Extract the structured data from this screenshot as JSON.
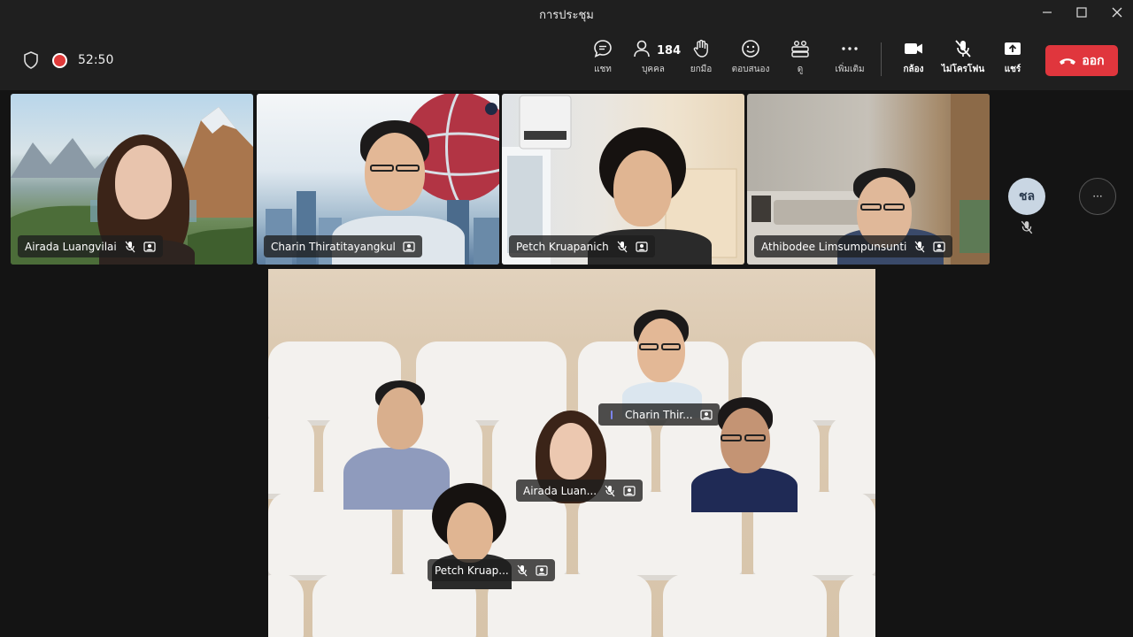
{
  "window": {
    "title": "การประชุม"
  },
  "toolbar": {
    "timer": "52:50",
    "chat_label": "แชท",
    "people_label": "บุคคล",
    "people_count": "184",
    "raise_label": "ยกมือ",
    "react_label": "ตอบสนอง",
    "view_label": "ดู",
    "more_label": "เพิ่มเติม",
    "camera_label": "กล้อง",
    "mic_label": "ไม่โครโฟน",
    "share_label": "แชร์",
    "leave_label": "ออก"
  },
  "participants": [
    {
      "name": "Airada Luangvilai"
    },
    {
      "name": "Charin Thiratitayangkul"
    },
    {
      "name": "Petch Kruapanich"
    },
    {
      "name": "Athibodee Limsumpunsunti"
    }
  ],
  "overflow": {
    "avatar_initials": "ชล",
    "more": "···"
  },
  "together_mode": {
    "labels": [
      {
        "name": "Charin Thir..."
      },
      {
        "name": "Airada Luan..."
      },
      {
        "name": "Petch Kruap..."
      }
    ]
  },
  "colors": {
    "accent": "#7b83eb",
    "leave": "#e0363d",
    "record": "#e03a3a"
  }
}
